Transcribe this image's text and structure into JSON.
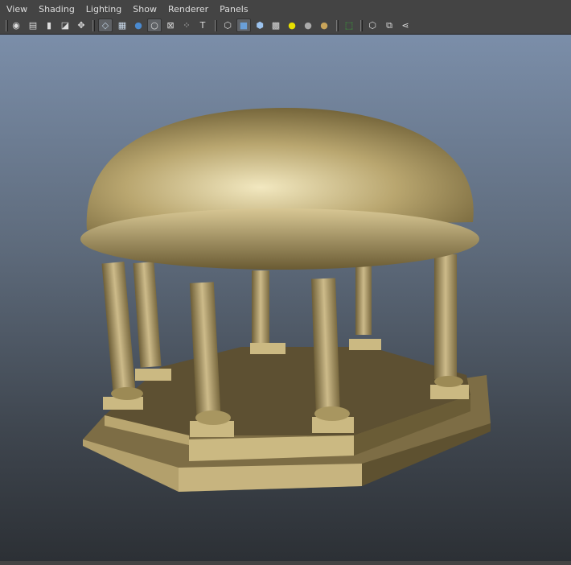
{
  "menus": [
    "View",
    "Shading",
    "Lighting",
    "Show",
    "Renderer",
    "Panels"
  ],
  "toolbar_icons": [
    {
      "name": "select-camera-icon",
      "glyph": "◉"
    },
    {
      "name": "camera-attributes-icon",
      "glyph": "▤"
    },
    {
      "name": "bookmarks-icon",
      "glyph": "▮"
    },
    {
      "name": "image-plane-icon",
      "glyph": "◪"
    },
    {
      "name": "2d-pan-zoom-icon",
      "glyph": "✥"
    },
    {
      "name": "grid-icon",
      "glyph": "◇"
    },
    {
      "name": "film-gate-icon",
      "glyph": "▦"
    },
    {
      "name": "resolution-gate-icon",
      "glyph": "●"
    },
    {
      "name": "gate-mask-icon",
      "glyph": "○"
    },
    {
      "name": "field-chart-icon",
      "glyph": "⊠"
    },
    {
      "name": "safe-action-icon",
      "glyph": "⁘"
    },
    {
      "name": "safe-title-icon",
      "glyph": "T"
    },
    {
      "name": "wireframe-icon",
      "glyph": "⬡"
    },
    {
      "name": "smooth-shade-icon",
      "glyph": "■"
    },
    {
      "name": "wireframe-on-shaded-icon",
      "glyph": "⬢"
    },
    {
      "name": "textured-icon",
      "glyph": "▩"
    },
    {
      "name": "use-all-lights-icon",
      "glyph": "●"
    },
    {
      "name": "shadows-icon",
      "glyph": "●"
    },
    {
      "name": "high-quality-icon",
      "glyph": "●"
    },
    {
      "name": "select-highlight-icon",
      "glyph": "⬚"
    },
    {
      "name": "isolate-select-icon",
      "glyph": "⬡"
    },
    {
      "name": "xray-icon",
      "glyph": "⧉"
    },
    {
      "name": "share-icon",
      "glyph": "⋖"
    }
  ],
  "colors": {
    "accent_yellow": "#e8e000",
    "gold": "#b5a06a"
  }
}
